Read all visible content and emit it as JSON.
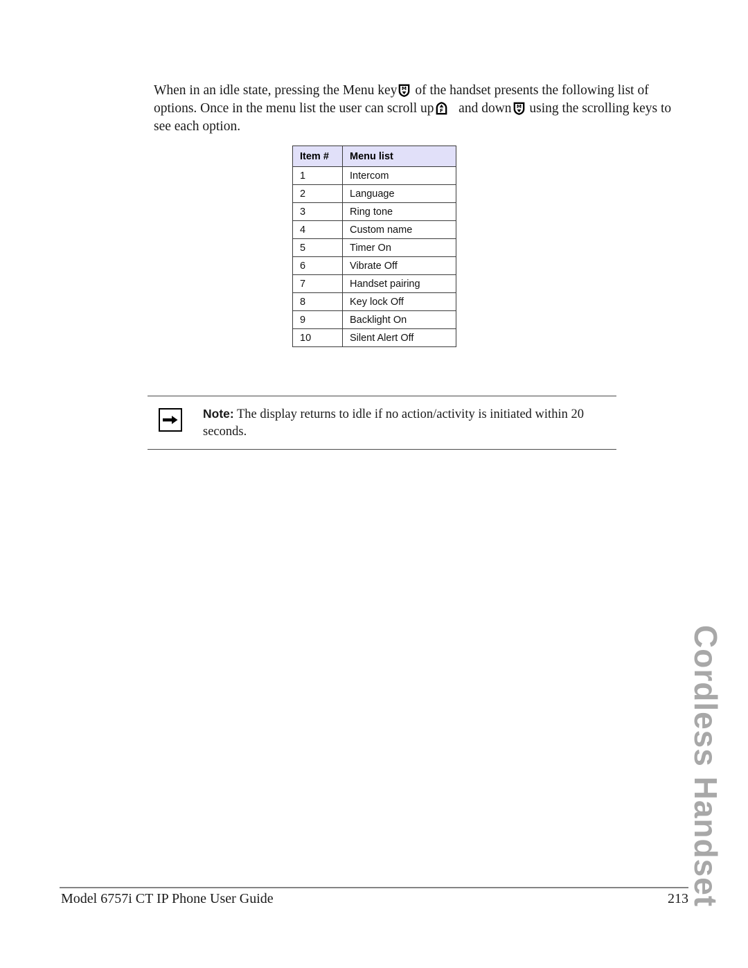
{
  "page": {
    "number": "213",
    "footer_title": "Model 6757i CT IP Phone User Guide",
    "side_chapter_title": "Cordless Handset"
  },
  "intro": {
    "part1": "When in an idle state, pressing the Menu key",
    "icon_menu_key": "menu-key-icon",
    "part2": " of the handset presents the following list of options. Once in the menu list the user can scroll up",
    "icon_scroll_up": "scroll-up-key-icon",
    "part3": "   and down",
    "icon_scroll_down": "scroll-down-key-icon",
    "part4": " using the scrolling keys to see each option."
  },
  "table": {
    "headers": [
      "Item #",
      "Menu list"
    ],
    "rows": [
      {
        "item": "1",
        "menu": "Intercom"
      },
      {
        "item": "2",
        "menu": "Language"
      },
      {
        "item": "3",
        "menu": "Ring tone"
      },
      {
        "item": "4",
        "menu": "Custom name"
      },
      {
        "item": "5",
        "menu": "Timer On"
      },
      {
        "item": "6",
        "menu": "Vibrate Off"
      },
      {
        "item": "7",
        "menu": "Handset pairing"
      },
      {
        "item": "8",
        "menu": "Key lock Off"
      },
      {
        "item": "9",
        "menu": "Backlight On"
      },
      {
        "item": "10",
        "menu": "Silent Alert Off"
      }
    ]
  },
  "note": {
    "icon": "right-arrow-icon",
    "label": "Note:",
    "text": " The display returns to idle if no action/activity is initiated within 20 seconds."
  },
  "colors": {
    "table_header_fill": "#E1E0F9",
    "table_border": "#3A3A3A",
    "side_title_gray": "#A8A8A8",
    "rule_gray": "#848484",
    "text_black": "#111111"
  }
}
